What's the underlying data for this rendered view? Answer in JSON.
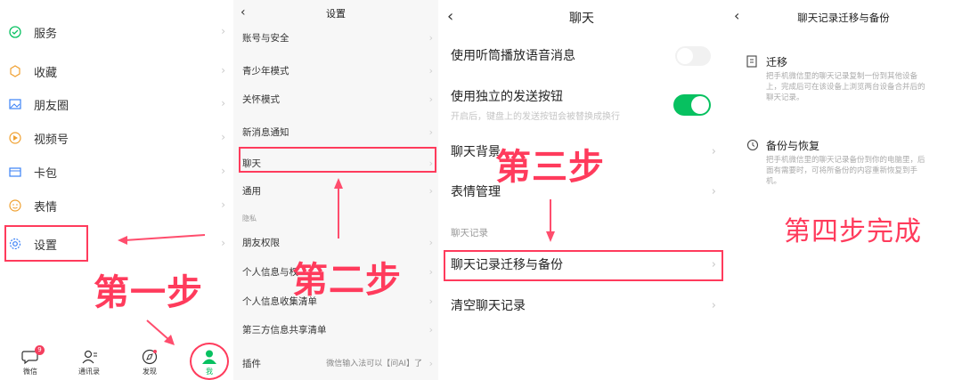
{
  "panel1": {
    "items": [
      {
        "label": "服务",
        "icon": "service-icon"
      },
      {
        "label": "收藏",
        "icon": "favorites-icon"
      },
      {
        "label": "朋友圈",
        "icon": "moments-icon"
      },
      {
        "label": "视频号",
        "icon": "channels-icon"
      },
      {
        "label": "卡包",
        "icon": "cards-icon"
      },
      {
        "label": "表情",
        "icon": "stickers-icon"
      },
      {
        "label": "设置",
        "icon": "gear-icon"
      }
    ],
    "step_label": "第一步",
    "tabs": [
      {
        "label": "微信",
        "badge": "9"
      },
      {
        "label": "通讯录"
      },
      {
        "label": "发现"
      },
      {
        "label": "我"
      }
    ],
    "accent": "#07c160"
  },
  "panel2": {
    "title": "设置",
    "items": [
      "账号与安全",
      "青少年模式",
      "关怀模式",
      "新消息通知",
      "聊天",
      "通用"
    ],
    "section": "隐私",
    "privacy_items": [
      "朋友权限",
      "个人信息与权",
      "个人信息收集清单",
      "第三方信息共享清单"
    ],
    "plugin_label": "插件",
    "plugin_value": "微信输入法可以【问AI】了",
    "step_label": "第二步"
  },
  "panel3": {
    "title": "聊天",
    "items": {
      "earpiece": "使用听筒播放语音消息",
      "send_button": "使用独立的发送按钮",
      "send_button_desc": "开启后，键盘上的发送按钮会被替换成换行",
      "background": "聊天背景",
      "stickers": "表情管理",
      "section": "聊天记录",
      "migrate": "聊天记录迁移与备份",
      "clear": "清空聊天记录"
    },
    "step_label": "第三步"
  },
  "panel4": {
    "title": "聊天记录迁移与备份",
    "migrate_title": "迁移",
    "migrate_desc": "把手机微信里的聊天记录复制一份到其他设备上，完成后可在该设备上浏览两台设备合并后的聊天记录。",
    "backup_title": "备份与恢复",
    "backup_desc": "把手机微信里的聊天记录备份到你的电脑里，后面有需要时，可将所备份的内容重新恢复到手机。",
    "step_label": "第四步完成"
  },
  "colors": {
    "highlight": "#ff3b5c",
    "toggle": "#07c160"
  }
}
